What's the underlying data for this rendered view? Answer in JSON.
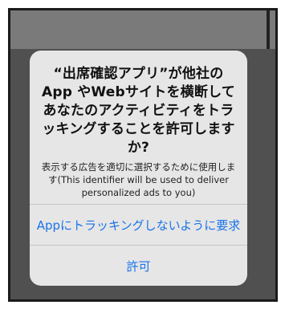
{
  "dialog": {
    "title": "“出席確認アプリ”が他社の App やWebサイトを横断してあなたのアクティビティをトラッキングすることを許可しますか?",
    "message": "表示する広告を適切に選択するために使用します(This identifier will be used to deliver personalized ads to you)",
    "ask_not_to_track_label": "Appにトラッキングしないように要求",
    "allow_label": "許可"
  },
  "colors": {
    "accent": "#1a73e8",
    "dialog_bg": "#e6e6e6",
    "backdrop": "#505050"
  }
}
